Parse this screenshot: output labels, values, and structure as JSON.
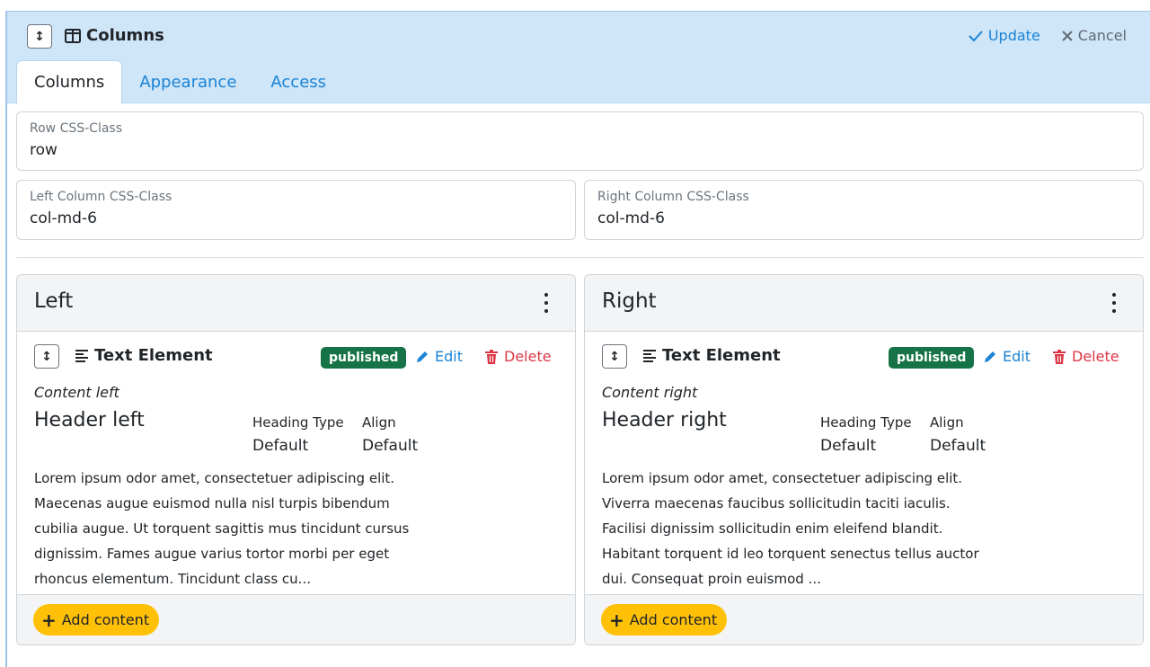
{
  "header": {
    "title": "Columns",
    "drag_icon": "drag-vertical-icon",
    "title_icon": "columns-icon",
    "update_label": "Update",
    "cancel_label": "Cancel"
  },
  "tabs": [
    {
      "label": "Columns",
      "active": true
    },
    {
      "label": "Appearance",
      "active": false
    },
    {
      "label": "Access",
      "active": false
    }
  ],
  "fields": {
    "row_css": {
      "label": "Row CSS-Class",
      "value": "row"
    },
    "left_css": {
      "label": "Left Column CSS-Class",
      "value": "col-md-6"
    },
    "right_css": {
      "label": "Right Column CSS-Class",
      "value": "col-md-6"
    }
  },
  "columns": [
    {
      "title": "Left",
      "element": {
        "type_label": "Text Element",
        "status": "published",
        "edit_label": "Edit",
        "delete_label": "Delete",
        "caption": "Content left",
        "heading": "Header left",
        "heading_type_label": "Heading Type",
        "heading_type_value": "Default",
        "align_label": "Align",
        "align_value": "Default",
        "body_lines": [
          "Lorem ipsum odor amet, consectetuer adipiscing elit.",
          "Maecenas augue euismod nulla nisl turpis bibendum",
          "cubilia augue. Ut torquent sagittis mus tincidunt cursus",
          "dignissim. Fames augue varius tortor morbi per eget",
          "rhoncus elementum. Tincidunt class cu..."
        ]
      },
      "add_label": "Add content"
    },
    {
      "title": "Right",
      "element": {
        "type_label": "Text Element",
        "status": "published",
        "edit_label": "Edit",
        "delete_label": "Delete",
        "caption": "Content right",
        "heading": "Header right",
        "heading_type_label": "Heading Type",
        "heading_type_value": "Default",
        "align_label": "Align",
        "align_value": "Default",
        "body_lines": [
          "Lorem ipsum odor amet, consectetuer adipiscing elit.",
          "Viverra maecenas faucibus sollicitudin taciti iaculis.",
          "Facilisi dignissim sollicitudin enim eleifend blandit.",
          "Habitant torquent id leo torquent senectus tellus auctor",
          "dui. Consequat proin euismod ..."
        ]
      },
      "add_label": "Add content"
    }
  ],
  "colors": {
    "header_bg": "#cfe5f8",
    "link": "#1b84d6",
    "published": "#157347",
    "delete": "#dc3545",
    "add_button": "#ffc107"
  }
}
